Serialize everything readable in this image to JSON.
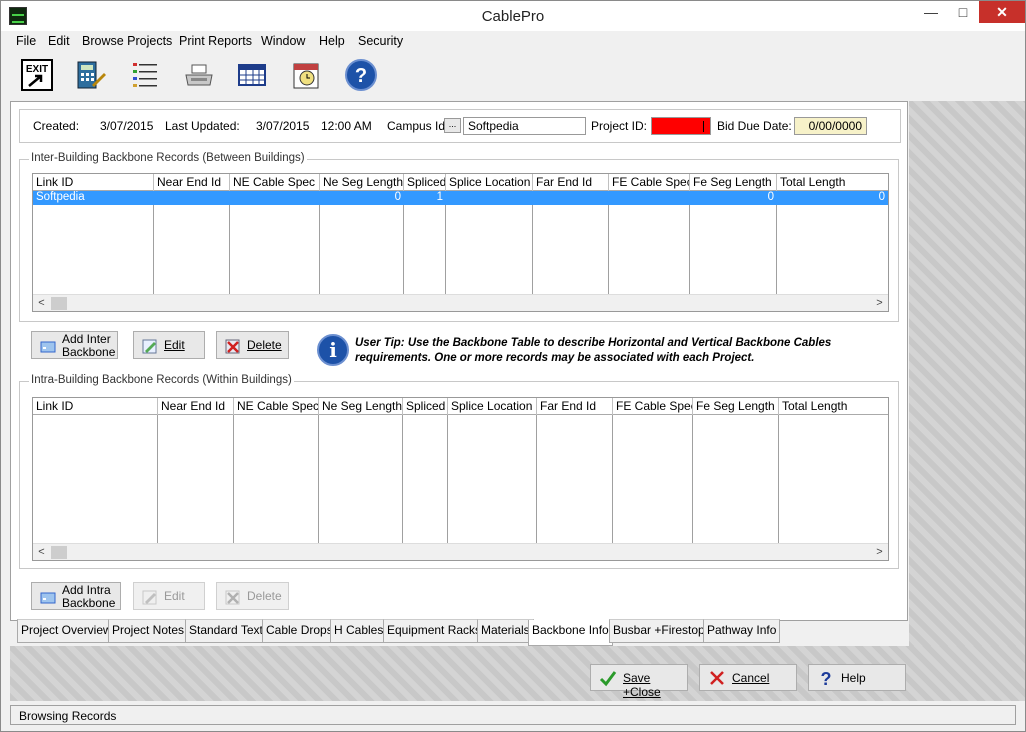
{
  "window": {
    "title": "CablePro",
    "minimize": "—",
    "maximize": "□",
    "close": "✕"
  },
  "menu": [
    "File",
    "Edit",
    "Browse Projects",
    "Print Reports",
    "Window",
    "Help",
    "Security"
  ],
  "toolbar": {
    "exit_label": "EXIT"
  },
  "header": {
    "created_label": "Created:",
    "created_value": "3/07/2015",
    "updated_label": "Last Updated:",
    "updated_date": "3/07/2015",
    "updated_time": "12:00 AM",
    "campus_label": "Campus Id:",
    "campus_btn": "...",
    "campus_value": "Softpedia",
    "project_label": "Project ID:",
    "bid_label": "Bid Due Date:",
    "bid_value": "0/00/0000"
  },
  "inter": {
    "title": "Inter-Building Backbone Records (Between Buildings)",
    "columns": [
      "Link ID",
      "Near End Id",
      "NE Cable Spec",
      "Ne Seg Length",
      "Spliced",
      "Splice Location",
      "Far End Id",
      "FE Cable Spec",
      "Fe Seg Length",
      "Total Length"
    ],
    "rows": [
      {
        "link_id": "Softpedia",
        "ne_seg": "0",
        "spliced": "1",
        "fe_seg": "0",
        "total": "0"
      }
    ],
    "add_label": "Add Inter Backbone",
    "edit_label": "Edit",
    "delete_label": "Delete"
  },
  "tip": {
    "text": "User Tip: Use the Backbone Table to describe Horizontal and Vertical Backbone Cables requirements. One or more records may be associated with each Project."
  },
  "intra": {
    "title": "Intra-Building Backbone Records (Within Buildings)",
    "columns": [
      "Link ID",
      "Near End Id",
      "NE Cable Spec (",
      "Ne Seg Length",
      "Spliced",
      "Splice Location",
      "Far End Id",
      "FE Cable Spec (",
      "Fe Seg Length",
      "Total Length"
    ],
    "add_label": "Add Intra Backbone",
    "edit_label": "Edit",
    "delete_label": "Delete"
  },
  "scroll": {
    "left": "<",
    "right": ">"
  },
  "tabs": [
    "Project Overview",
    "Project Notes:",
    "Standard Text",
    "Cable Drops",
    "H Cables",
    "Equipment Racks",
    "Materials",
    "Backbone Info",
    "Busbar +Firestops",
    "Pathway Info"
  ],
  "active_tab": "Backbone Info",
  "bottom_buttons": {
    "save": "Save +Close",
    "cancel": "Cancel",
    "help": "Help"
  },
  "status": "Browsing Records",
  "colors": {
    "selection": "#3399ff",
    "project_id_bg": "#ff0000",
    "bid_bg": "#f7f2c9",
    "help_blue": "#1d52a8"
  }
}
